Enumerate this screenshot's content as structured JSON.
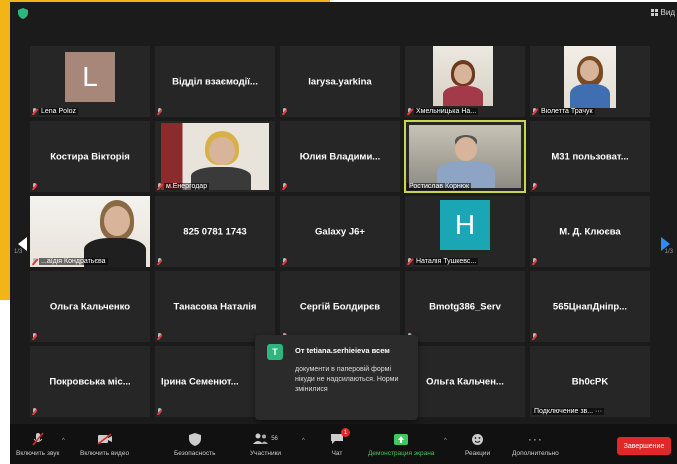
{
  "colors": {
    "accent": "#f3b417",
    "active_speaker": "#c7d64a",
    "end_button": "#e02828",
    "share_green": "#42c95b",
    "chat_icon": "#2eb67d"
  },
  "topbar": {
    "view_label": "Вид"
  },
  "navigation": {
    "prev_page_indicator": "1/3",
    "next_page_indicator": "1/3"
  },
  "participants": [
    {
      "display": "",
      "caption": "Lena Poloz",
      "avatar_letter": "L"
    },
    {
      "display": "Відділ взаємодії...",
      "caption": ""
    },
    {
      "display": "larysa.yarkina",
      "caption": ""
    },
    {
      "display": "",
      "caption": "Хмельницька На..."
    },
    {
      "display": "",
      "caption": "Віолетта Трачук"
    },
    {
      "display": "Костирa Вікторія",
      "caption": ""
    },
    {
      "display": "",
      "caption": "м.Енергодар"
    },
    {
      "display": "Юлия Владими...",
      "caption": ""
    },
    {
      "display": "",
      "caption": "Ростислав Корнюк"
    },
    {
      "display": "М31 пользоват...",
      "caption": ""
    },
    {
      "display": "",
      "caption": "...аїдія Кондратьєва"
    },
    {
      "display": "825 0781 1743",
      "caption": ""
    },
    {
      "display": "Galaxy J6+",
      "caption": ""
    },
    {
      "display": "",
      "caption": "Наталія Тушкевс...",
      "avatar_letter": "H"
    },
    {
      "display": "М. Д. Клюєва",
      "caption": ""
    },
    {
      "display": "Ольга Кальченко",
      "caption": ""
    },
    {
      "display": "Танасова Наталія",
      "caption": ""
    },
    {
      "display": "Сергій Болдирєв",
      "caption": ""
    },
    {
      "display": "Bmotg386_Serv",
      "caption": ""
    },
    {
      "display": "565ЦнапДніпр...",
      "caption": ""
    },
    {
      "display": "Покровська міс...",
      "caption": ""
    },
    {
      "display": "Ірина Семенют...",
      "caption": ""
    },
    {
      "display": "",
      "caption": ""
    },
    {
      "display": "Ольга Кальчен...",
      "caption": ""
    },
    {
      "display": "Bh0cPK",
      "caption": "Подключение зв... ···"
    }
  ],
  "chat_popup": {
    "icon_letter": "T",
    "from": "От tetiana.serhieieva всем",
    "message": "документи в паперовій формі нікуди не надсилаються. Норми змінилися"
  },
  "toolbar": {
    "unmute": "Включить звук",
    "start_video": "Включить видео",
    "security": "Безопасность",
    "participants": "Участники",
    "participants_count": "56",
    "chat": "Чат",
    "chat_badge": "1",
    "share_screen": "Демонстрация экрана",
    "reactions": "Реакции",
    "more": "Дополнительно",
    "end": "Завершение"
  }
}
